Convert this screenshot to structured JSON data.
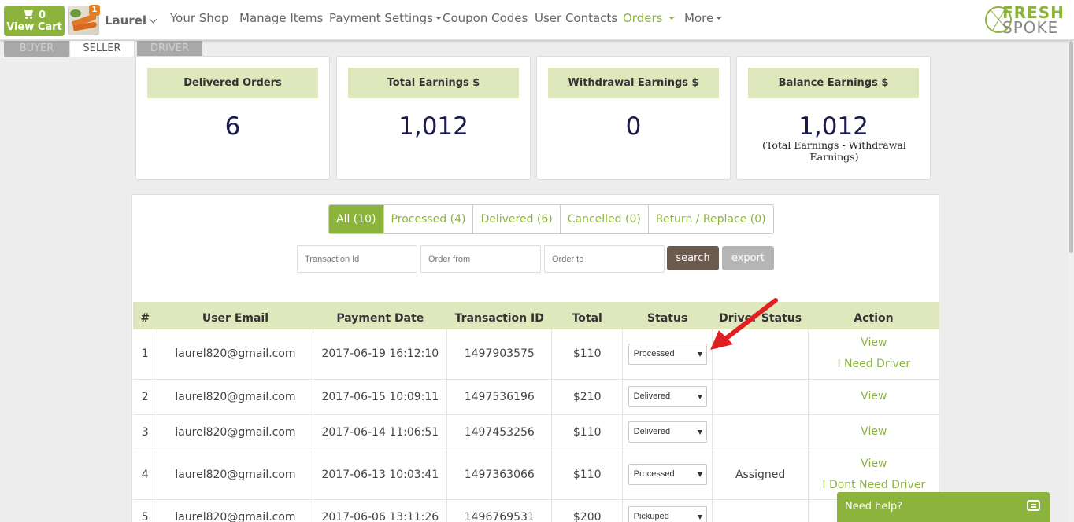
{
  "nav": {
    "cart_count": "0",
    "cart_label": "View Cart",
    "notification_count": "1",
    "user_name": "Laurel",
    "links": {
      "your_shop": "Your Shop",
      "manage_items": "Manage Items",
      "payment_settings": "Payment Settings",
      "coupon_codes": "Coupon Codes",
      "user_contacts": "User Contacts",
      "orders": "Orders",
      "more": "More"
    },
    "logo_top": "FRESH",
    "logo_bottom": "SPOKE"
  },
  "roles": {
    "buyer": "BUYER",
    "seller": "SELLER",
    "driver": "DRIVER"
  },
  "stats": {
    "delivered_orders": {
      "label": "Delivered Orders",
      "value": "6"
    },
    "total_earnings": {
      "label": "Total Earnings $",
      "value": "1,012"
    },
    "withdrawal_earnings": {
      "label": "Withdrawal Earnings $",
      "value": "0"
    },
    "balance_earnings": {
      "label": "Balance Earnings $",
      "value": "1,012",
      "note": "(Total Earnings - Withdrawal Earnings)"
    }
  },
  "filters": {
    "all": "All (10)",
    "processed": "Processed (4)",
    "delivered": "Delivered (6)",
    "cancelled": "Cancelled (0)",
    "return_replace": "Return / Replace (0)"
  },
  "search": {
    "transaction_placeholder": "Transaction Id",
    "order_from_placeholder": "Order from",
    "order_to_placeholder": "Order to",
    "search_label": "search",
    "export_label": "export"
  },
  "table": {
    "headers": {
      "num": "#",
      "email": "User Email",
      "date": "Payment Date",
      "txn": "Transaction ID",
      "total": "Total",
      "status": "Status",
      "driver": "Driver Status",
      "action": "Action"
    },
    "rows": [
      {
        "num": "1",
        "email": "laurel820@gmail.com",
        "date": "2017-06-19 16:12:10",
        "txn": "1497903575",
        "total": "$110",
        "status": "Processed",
        "driver": "",
        "action1": "View",
        "action2": "I Need Driver"
      },
      {
        "num": "2",
        "email": "laurel820@gmail.com",
        "date": "2017-06-15 10:09:11",
        "txn": "1497536196",
        "total": "$210",
        "status": "Delivered",
        "driver": "",
        "action1": "View",
        "action2": ""
      },
      {
        "num": "3",
        "email": "laurel820@gmail.com",
        "date": "2017-06-14 11:06:51",
        "txn": "1497453256",
        "total": "$110",
        "status": "Delivered",
        "driver": "",
        "action1": "View",
        "action2": ""
      },
      {
        "num": "4",
        "email": "laurel820@gmail.com",
        "date": "2017-06-13 10:03:41",
        "txn": "1497363066",
        "total": "$110",
        "status": "Processed",
        "driver": "Assigned",
        "action1": "View",
        "action2": "I Dont Need Driver"
      },
      {
        "num": "5",
        "email": "laurel820@gmail.com",
        "date": "2017-06-06 13:11:26",
        "txn": "1496769531",
        "total": "$200",
        "status": "Pickuped",
        "driver": "",
        "action1": "",
        "action2": ""
      }
    ]
  },
  "help": {
    "label": "Need help?"
  },
  "colors": {
    "accent": "#8cb43c",
    "header_band": "#dfe8bd",
    "search_button": "#6b5a4e",
    "assigned": "#dd3333",
    "annotation_arrow": "#e02020"
  }
}
